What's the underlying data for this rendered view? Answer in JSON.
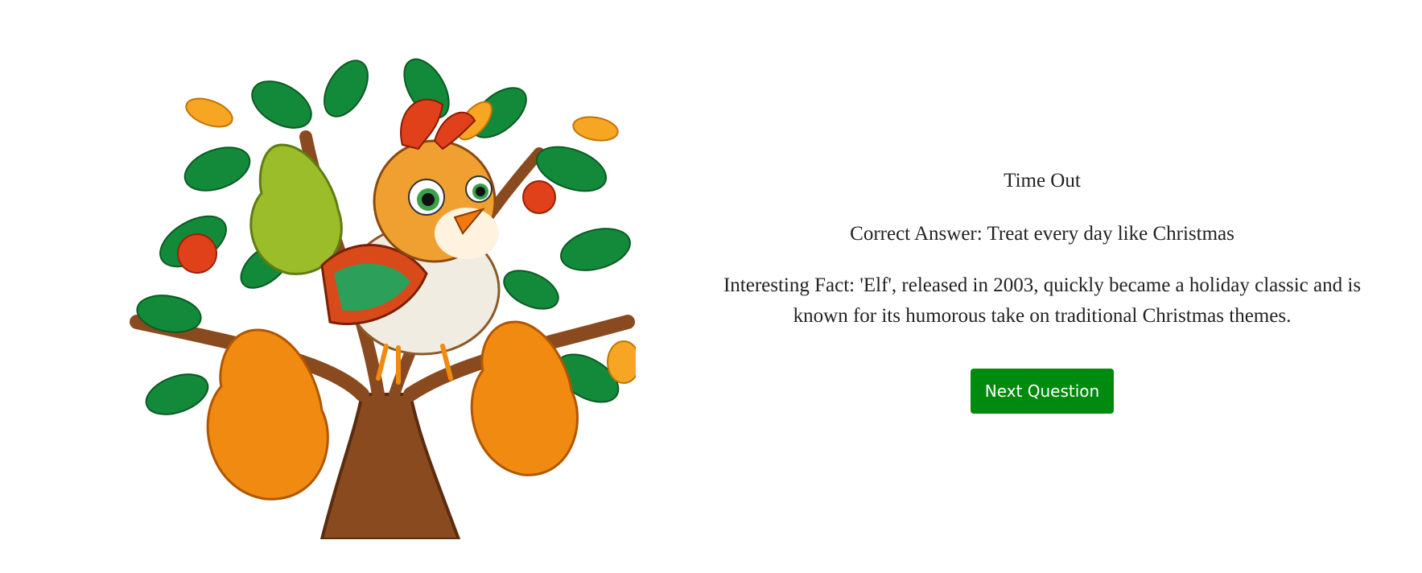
{
  "result": {
    "status": "Time Out",
    "correct_answer": "Correct Answer: Treat every day like Christmas",
    "interesting_fact": "Interesting Fact: 'Elf', released in 2003, quickly became a holiday classic and is known for its humorous take on traditional Christmas themes."
  },
  "actions": {
    "next_label": "Next Question"
  },
  "colors": {
    "button_background": "#008a0e",
    "button_text": "#ffffff",
    "text": "#222222",
    "background": "#ffffff"
  },
  "illustration": {
    "icon": "partridge-in-pear-tree-illustration"
  }
}
